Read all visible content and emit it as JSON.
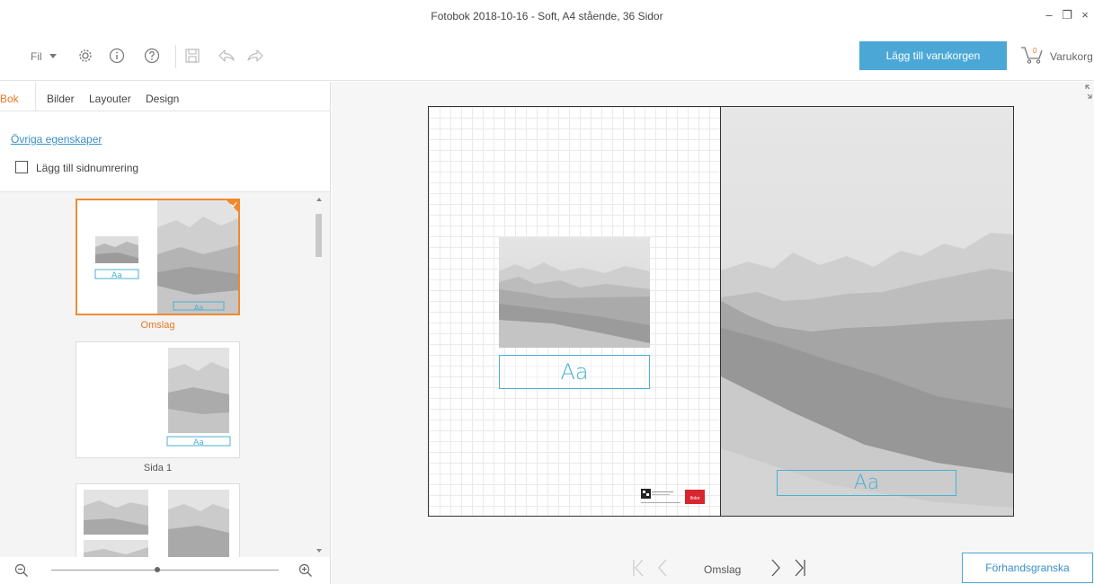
{
  "window": {
    "title": "Fotobok 2018-10-16 - Soft, A4 stående, 36 Sidor",
    "minimize_glyph": "–",
    "restore_glyph": "❐",
    "close_glyph": "×"
  },
  "toolbar": {
    "file_label": "Fil",
    "settings_icon": "gear-icon",
    "info_icon": "info-icon",
    "help_icon": "help-icon",
    "save_icon": "save-icon",
    "undo_icon": "undo-icon",
    "redo_icon": "redo-icon",
    "add_to_cart_label": "Lägg till varukorgen",
    "cart_count": "0",
    "cart_label": "Varukorg"
  },
  "left_panel": {
    "tabs": [
      {
        "label": "Bok",
        "active": true
      },
      {
        "label": "Bilder",
        "active": false
      },
      {
        "label": "Layouter",
        "active": false
      },
      {
        "label": "Design",
        "active": false
      }
    ],
    "properties_link": "Övriga egenskaper",
    "page_numbering_label": "Lägg till sidnumrering",
    "page_numbering_checked": false,
    "thumbnails": [
      {
        "label": "Omslag",
        "selected": true
      },
      {
        "label": "Sida 1",
        "selected": false
      },
      {
        "label": "",
        "selected": false
      }
    ],
    "text_placeholder": "Aa"
  },
  "canvas": {
    "left_textbox": "Aa",
    "right_textbox": "Aa",
    "barcode_brand": "Ifolor"
  },
  "footer": {
    "current_page_label": "Omslag",
    "preview_button": "Förhandsgranska"
  },
  "colors": {
    "accent_blue": "#4ba8d6",
    "accent_orange": "#e87722",
    "textbox_blue": "#4ab0d4"
  }
}
